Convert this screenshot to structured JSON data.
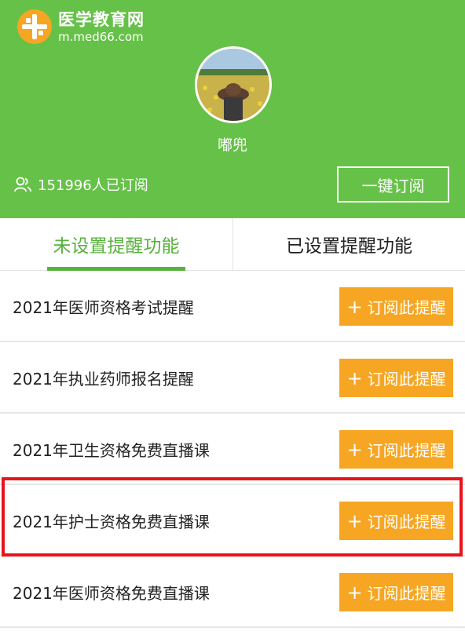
{
  "site": {
    "name": "医学教育网",
    "url": "m.med66.com"
  },
  "profile": {
    "username": "嘟兜",
    "subscriber_count": "151996人已订阅",
    "subscribe_all_label": "一键订阅"
  },
  "tabs": [
    {
      "label": "未设置提醒功能",
      "active": true
    },
    {
      "label": "已设置提醒功能",
      "active": false
    }
  ],
  "reminders": [
    {
      "title": "2021年医师资格考试提醒",
      "button": "订阅此提醒"
    },
    {
      "title": "2021年执业药师报名提醒",
      "button": "订阅此提醒"
    },
    {
      "title": "2021年卫生资格免费直播课",
      "button": "订阅此提醒"
    },
    {
      "title": "2021年护士资格免费直播课",
      "button": "订阅此提醒",
      "highlighted": true
    },
    {
      "title": "2021年医师资格免费直播课",
      "button": "订阅此提醒"
    }
  ],
  "colors": {
    "header": "#66c149",
    "accent_green": "#58b13c",
    "button_orange": "#f6a623",
    "highlight_red": "#e8141b"
  },
  "icons": {
    "logo": "med66-logo-icon",
    "subscribers": "user-group-icon",
    "add": "plus-icon"
  }
}
